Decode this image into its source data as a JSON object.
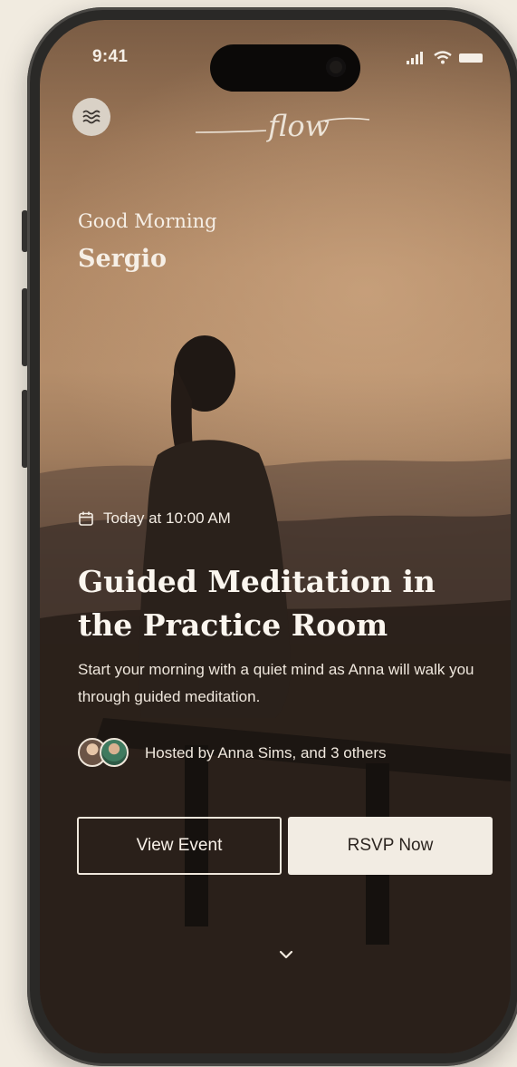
{
  "status_bar": {
    "time": "9:41"
  },
  "header": {
    "logo_text": "flow",
    "menu_icon": "waves-icon"
  },
  "greeting": {
    "salutation": "Good Morning",
    "user_name": "Sergio"
  },
  "event": {
    "time_label": "Today at 10:00 AM",
    "title": "Guided Meditation in the Practice Room",
    "description": "Start your morning with a quiet mind as Anna will walk you through guided meditation.",
    "hosts_text": "Hosted by Anna Sims, and 3 others"
  },
  "actions": {
    "view_event_label": "View Event",
    "rsvp_label": "RSVP Now"
  },
  "colors": {
    "page_background": "#f1ebe0",
    "phone_frame": "#2a2927",
    "accent_light": "#f2ece3",
    "text_light": "#f6efe6"
  }
}
